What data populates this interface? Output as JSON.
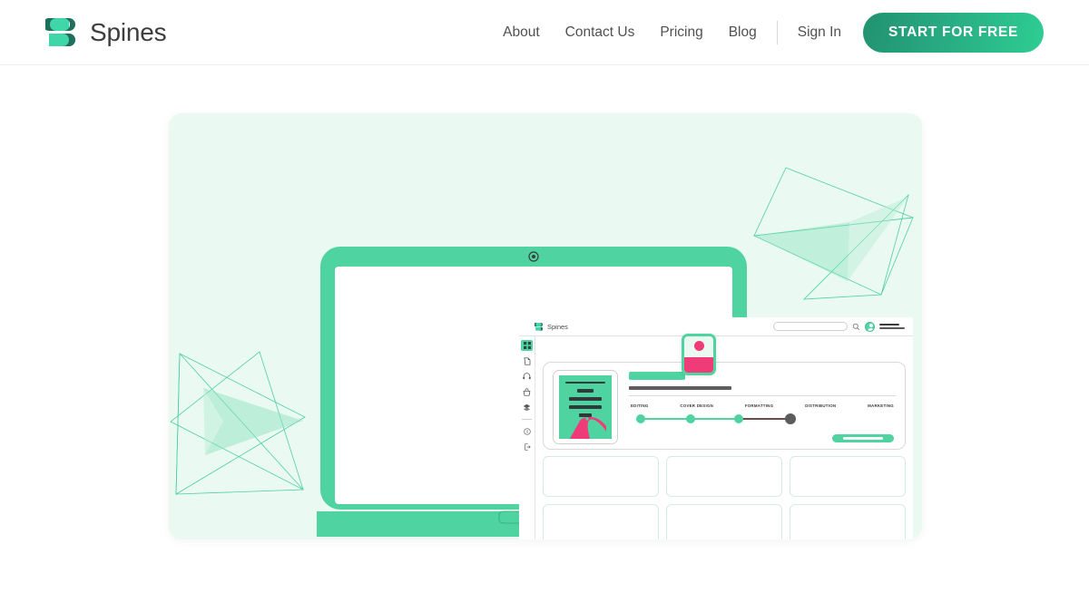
{
  "nav": {
    "brand": {
      "name": "Spines",
      "logo_icon": "spines-logo-icon",
      "colors": {
        "light": "#3fd6a8",
        "dark": "#1f6f5e"
      }
    },
    "links": [
      {
        "label": "About",
        "name": "about"
      },
      {
        "label": "Contact Us",
        "name": "contact-us"
      },
      {
        "label": "Pricing",
        "name": "pricing"
      },
      {
        "label": "Blog",
        "name": "blog"
      }
    ],
    "signin_label": "Sign In",
    "cta_label": "START FOR FREE",
    "cta_colors": {
      "from": "#21926f",
      "to": "#2ecd93"
    }
  },
  "hero": {
    "background": "#eafaf2",
    "decorations": {
      "icon": "wireframe-star-polyhedron-icon",
      "stroke": "#4ecfa0"
    },
    "laptop": {
      "shell_color": "#4ed3a1",
      "camera_icon": "webcam-icon"
    }
  },
  "app": {
    "logo_text": "Spines",
    "logo_icon": "spines-logo-icon",
    "search": {
      "icon": "search-icon",
      "placeholder": ""
    },
    "avatar_icon": "user-avatar-icon",
    "sidebar": [
      {
        "name": "dashboard",
        "icon": "grid-dashboard-icon",
        "active": true
      },
      {
        "name": "documents",
        "icon": "document-icon",
        "active": false
      },
      {
        "name": "support",
        "icon": "headphones-icon",
        "active": false
      },
      {
        "name": "store",
        "icon": "shopping-bag-icon",
        "active": false
      },
      {
        "name": "layers",
        "icon": "layers-stack-icon",
        "active": false
      },
      {
        "name": "info",
        "icon": "info-circle-icon",
        "active": false
      },
      {
        "name": "logout",
        "icon": "logout-icon",
        "active": false
      }
    ],
    "project": {
      "cover_icon": "book-cover-thumbnail",
      "cover_bg": "#4ed3a1",
      "cover_accent": "#ef3b77",
      "title_placeholder": "",
      "action_button_label": ""
    },
    "progress": {
      "steps": [
        {
          "label": "EDITING",
          "state": "complete"
        },
        {
          "label": "COVER DESIGN",
          "state": "complete"
        },
        {
          "label": "FORMATTING",
          "state": "complete"
        },
        {
          "label": "DISTRIBUTION",
          "state": "current"
        },
        {
          "label": "MARKETING",
          "state": "upcoming"
        }
      ],
      "complete_color": "#4ed3a1",
      "current_color": "#5c5c5c"
    },
    "cards_count": 6,
    "float_card": {
      "icon": "book-preview-card",
      "accent": "#ef3b77",
      "border": "#4ed3a1"
    }
  }
}
